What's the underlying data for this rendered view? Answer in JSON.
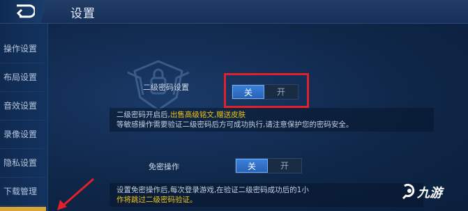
{
  "header": {
    "title": "设置"
  },
  "sidebar": {
    "items": [
      {
        "label": "操作设置"
      },
      {
        "label": "布局设置"
      },
      {
        "label": "音效设置"
      },
      {
        "label": "录像设置"
      },
      {
        "label": "隐私设置"
      },
      {
        "label": "下载管理"
      }
    ]
  },
  "secondary_password": {
    "label": "二级密码设置",
    "toggle_off": "关",
    "toggle_on": "开",
    "selected": "关",
    "desc_prefix": "二级密码开启后,",
    "desc_highlight": "出售高级铭文,赠送皮肤",
    "desc_line2": "等敏感操作需要验证二级密码后方可成功执行,请注意保护您的密码安全。"
  },
  "password_free": {
    "label": "免密操作",
    "toggle_off": "关",
    "toggle_on": "开",
    "selected": "关",
    "desc_line1": "设置免密操作后,每次登录游戏,在验证二级密码成功后的1小",
    "desc_highlight": "作将跳过二级密码验证。"
  },
  "watermark": {
    "text": "九游"
  },
  "colors": {
    "highlight": "#f0c419",
    "annotation_red": "#e0202a",
    "toggle_active": "#2a63b6"
  }
}
